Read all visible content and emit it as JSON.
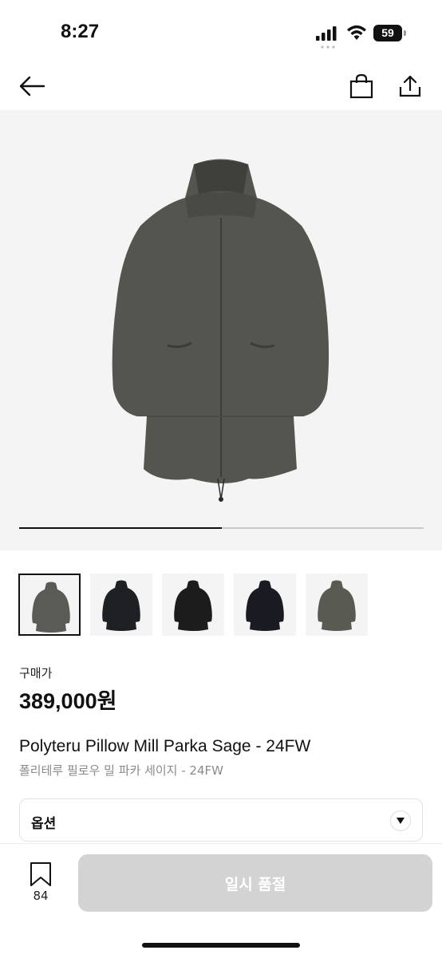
{
  "status_bar": {
    "time": "8:27",
    "battery": "59"
  },
  "product": {
    "image_progress": 0.5,
    "thumbnails": [
      {
        "color": "#5a5a56",
        "selected": true
      },
      {
        "color": "#1e2023",
        "selected": false
      },
      {
        "color": "#1c1c1c",
        "selected": false
      },
      {
        "color": "#1a1b22",
        "selected": false
      },
      {
        "color": "#595a52",
        "selected": false
      }
    ],
    "price_label": "구매가",
    "price": "389,000원",
    "title_en": "Polyteru Pillow Mill Parka Sage - 24FW",
    "title_ko": "폴리테루 필로우 밀 파카 세이지 - 24FW"
  },
  "options": {
    "label": "옵션"
  },
  "bottom": {
    "bookmark_count": "84",
    "soldout_label": "일시 품절"
  },
  "colors": {
    "parka": "#55554f",
    "hero_bg": "#f4f4f4",
    "button_disabled": "#d3d3d3"
  }
}
